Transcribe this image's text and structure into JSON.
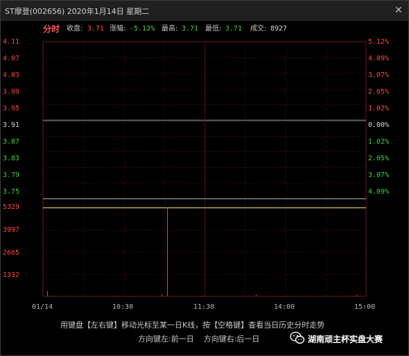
{
  "window": {
    "title": "ST摩登(002656) 2020年1月14日 星期二",
    "close_glyph": "✕"
  },
  "header": {
    "mode_label": "分时",
    "close_label": "收盘:",
    "close_value": "3.71",
    "change_label": "涨幅:",
    "change_value": "-5.12%",
    "high_label": "最高:",
    "high_value": "3.71",
    "low_label": "最低:",
    "low_value": "3.71",
    "volume_label": "成交:",
    "volume_value": "8927"
  },
  "price_axis": {
    "labels": [
      "4.11",
      "4.07",
      "4.03",
      "3.99",
      "3.95",
      "3.91",
      "3.87",
      "3.83",
      "3.79",
      "3.75"
    ],
    "pct_labels": [
      "5.12%",
      "4.09%",
      "3.07%",
      "2.05%",
      "1.02%",
      "0.00%",
      "1.02%",
      "2.05%",
      "3.07%",
      "4.09%"
    ]
  },
  "volume_axis": {
    "labels": [
      "5329",
      "3997",
      "2665",
      "1332"
    ]
  },
  "time_axis": {
    "labels": [
      "01/14",
      "10:30",
      "11:30",
      "14:00",
      "15:00"
    ]
  },
  "chart_data": {
    "type": "line",
    "title": "",
    "price": {
      "prev_close": 3.91,
      "ylim": [
        3.71,
        4.11
      ],
      "close": 3.71
    },
    "volume": {
      "ylim": [
        0,
        5329
      ],
      "max_line": 5329,
      "bars_minutes": [
        {
          "minute": 3,
          "volume": 300
        },
        {
          "minute": 6,
          "volume": 30
        },
        {
          "minute": 20,
          "volume": 25
        },
        {
          "minute": 40,
          "volume": 30
        },
        {
          "minute": 55,
          "volume": 35
        },
        {
          "minute": 73,
          "volume": 25
        },
        {
          "minute": 88,
          "volume": 130
        },
        {
          "minute": 92,
          "volume": 5329
        },
        {
          "minute": 95,
          "volume": 30
        },
        {
          "minute": 118,
          "volume": 25
        },
        {
          "minute": 148,
          "volume": 30
        },
        {
          "minute": 158,
          "volume": 100
        },
        {
          "minute": 198,
          "volume": 30
        },
        {
          "minute": 225,
          "volume": 35
        },
        {
          "minute": 233,
          "volume": 90
        },
        {
          "minute": 236,
          "volume": 25
        }
      ]
    }
  },
  "colors": {
    "up": "#ff4848",
    "down": "#3ad83a",
    "grid": "#3a1010",
    "midline": "#606060",
    "volume_max_line": "#ffe36b",
    "volume_bar": "#ff4040"
  },
  "hints": {
    "line1": "用键盘【左右键】移动光标至某一日K线，按【空格键】查看当日历史分时走势",
    "line2": "方向键左:前一日    方向键右:后一日"
  },
  "watermark": {
    "text": "湖南顽主杯实盘大赛",
    "icon": "wechat-icon"
  }
}
